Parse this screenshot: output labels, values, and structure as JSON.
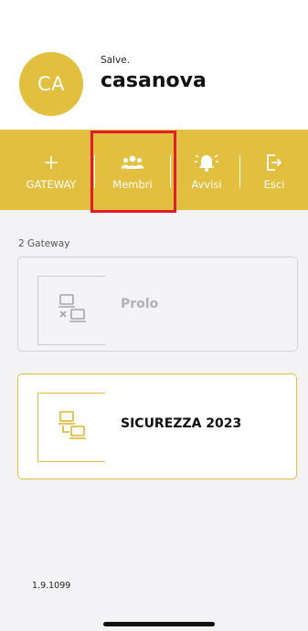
{
  "header": {
    "avatar_initials": "CA",
    "greeting": "Salve.",
    "username": "casanova"
  },
  "toolbar": {
    "gateway_label": "GATEWAY",
    "membri_label": "Membri",
    "avvisi_label": "Avvisi",
    "esci_label": "Esci"
  },
  "gateways": {
    "count_label": "2 Gateway",
    "items": [
      {
        "name": "Prolo",
        "status": "inactive",
        "icon": "gateway-offline-icon"
      },
      {
        "name": "SICUREZZA 2023",
        "status": "active",
        "icon": "gateway-online-icon"
      }
    ]
  },
  "footer": {
    "version": "1.9.1099"
  },
  "colors": {
    "accent": "#e2bf3e",
    "highlight": "#e21c2a",
    "inactive_text": "#b0b0b8"
  }
}
